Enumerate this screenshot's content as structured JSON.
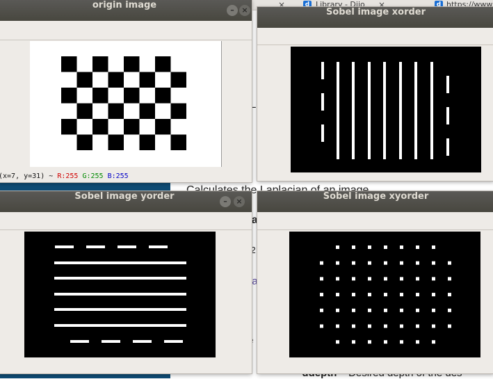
{
  "browser": {
    "tabs": [
      {
        "label": "Library - Dijo",
        "favicon": "d"
      },
      {
        "label": "https://www.",
        "favicon": "d"
      }
    ],
    "tab_close": "×"
  },
  "doc": {
    "heading": "Calculates the Laplacian of an image.",
    "frag_la": "La",
    "frag_l": "La",
    "frag_y2": "y2",
    "frag_la2": "La",
    "frag_dot": "·",
    "frag_e": "e",
    "bullet_term": "ddepth",
    "bullet_text": " – Desired depth of the des"
  },
  "windows": {
    "origin": {
      "title": "origin image",
      "status": {
        "coords": "(x=7, y=31) ~",
        "r": "R:255",
        "g": "G:255",
        "b": "B:255"
      }
    },
    "xorder": {
      "title": "Sobel image xorder"
    },
    "yorder": {
      "title": "Sobel image yorder"
    },
    "xyorder": {
      "title": "Sobel image xyorder"
    },
    "close_glyph": "×",
    "min_glyph": "–"
  },
  "colors": {
    "r": "#d00000",
    "g": "#008a00",
    "b": "#0000c8"
  }
}
